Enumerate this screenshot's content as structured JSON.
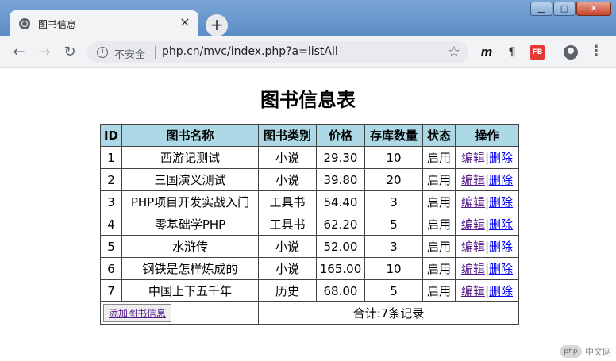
{
  "browser": {
    "tab_title": "图书信息",
    "close_glyph": "×",
    "new_tab_glyph": "+",
    "security_label": "不安全",
    "url": "php.cn/mvc/index.php?a=listAll",
    "ext_f_label": "FB"
  },
  "page": {
    "title": "图书信息表",
    "headers": [
      "ID",
      "图书名称",
      "图书类别",
      "价格",
      "存库数量",
      "状态",
      "操作"
    ],
    "rows": [
      {
        "id": "1",
        "name": "西游记测试",
        "category": "小说",
        "price": "29.30",
        "qty": "10",
        "status": "启用"
      },
      {
        "id": "2",
        "name": "三国演义测试",
        "category": "小说",
        "price": "39.80",
        "qty": "20",
        "status": "启用"
      },
      {
        "id": "3",
        "name": "PHP项目开发实战入门",
        "category": "工具书",
        "price": "54.40",
        "qty": "3",
        "status": "启用"
      },
      {
        "id": "4",
        "name": "零基础学PHP",
        "category": "工具书",
        "price": "62.20",
        "qty": "5",
        "status": "启用"
      },
      {
        "id": "5",
        "name": "水浒传",
        "category": "小说",
        "price": "52.00",
        "qty": "3",
        "status": "启用"
      },
      {
        "id": "6",
        "name": "钢铁是怎样炼成的",
        "category": "小说",
        "price": "165.00",
        "qty": "10",
        "status": "启用"
      },
      {
        "id": "7",
        "name": "中国上下五千年",
        "category": "历史",
        "price": "68.00",
        "qty": "5",
        "status": "启用"
      }
    ],
    "edit_label": "编辑",
    "action_sep": "|",
    "delete_label": "删除",
    "add_button": "添加图书信息",
    "total_text": "合计:7条记录"
  },
  "watermark": {
    "logo": "php",
    "text": "中文网"
  }
}
